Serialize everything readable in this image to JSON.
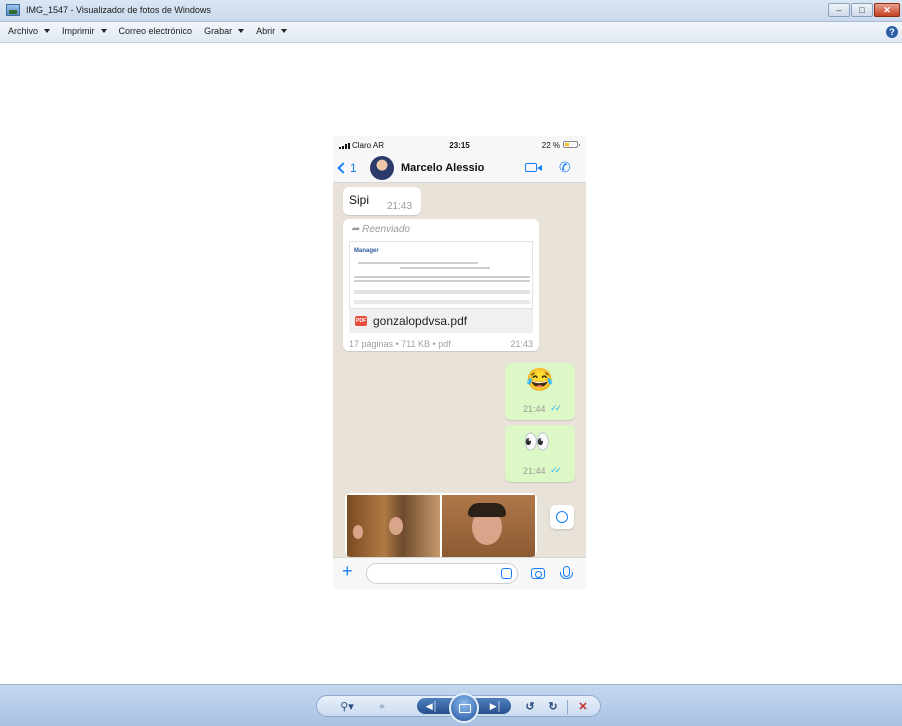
{
  "window": {
    "title": "IMG_1547 - Visualizador de fotos de Windows",
    "buttons": [
      "minimize",
      "maximize",
      "close"
    ]
  },
  "menubar": {
    "items": [
      {
        "label": "Archivo",
        "has_dropdown": true
      },
      {
        "label": "Imprimir",
        "has_dropdown": true
      },
      {
        "label": "Correo electrónico",
        "has_dropdown": false
      },
      {
        "label": "Grabar",
        "has_dropdown": true
      },
      {
        "label": "Abrir",
        "has_dropdown": true
      }
    ],
    "help_icon": "?"
  },
  "phone": {
    "status": {
      "carrier": "Claro AR",
      "time": "23:15",
      "battery": "22 %"
    },
    "header": {
      "back_count": "1",
      "contact": "Marcelo Alessio",
      "icons": [
        "video-icon",
        "phone-icon"
      ]
    },
    "messages": [
      {
        "type": "text",
        "direction": "in",
        "text": "Sipi",
        "time": "21:43"
      },
      {
        "type": "document",
        "direction": "in",
        "forwarded_label": "Reenviado",
        "filename": "gonzalopdvsa.pdf",
        "meta": "17 páginas • 711 KB • pdf",
        "time": "21:43",
        "preview_brand": "Manager"
      },
      {
        "type": "emoji",
        "direction": "out",
        "emoji": "😂",
        "time": "21:44",
        "read": true
      },
      {
        "type": "emoji",
        "direction": "out",
        "emoji": "👀",
        "time": "21:44",
        "read": true
      },
      {
        "type": "photo",
        "direction": "in"
      }
    ],
    "input": {
      "placeholder": ""
    }
  },
  "controls": {
    "items": [
      "zoom-icon",
      "fit-window-icon",
      "previous-icon",
      "slideshow-icon",
      "next-icon",
      "rotate-counterclockwise-icon",
      "rotate-clockwise-icon",
      "delete-icon"
    ]
  },
  "colors": {
    "accent": "#147efb",
    "outgoing_bubble": "#dcf8c6",
    "chat_bg": "#e8e2d8",
    "controlbar": "#b8cde8"
  }
}
